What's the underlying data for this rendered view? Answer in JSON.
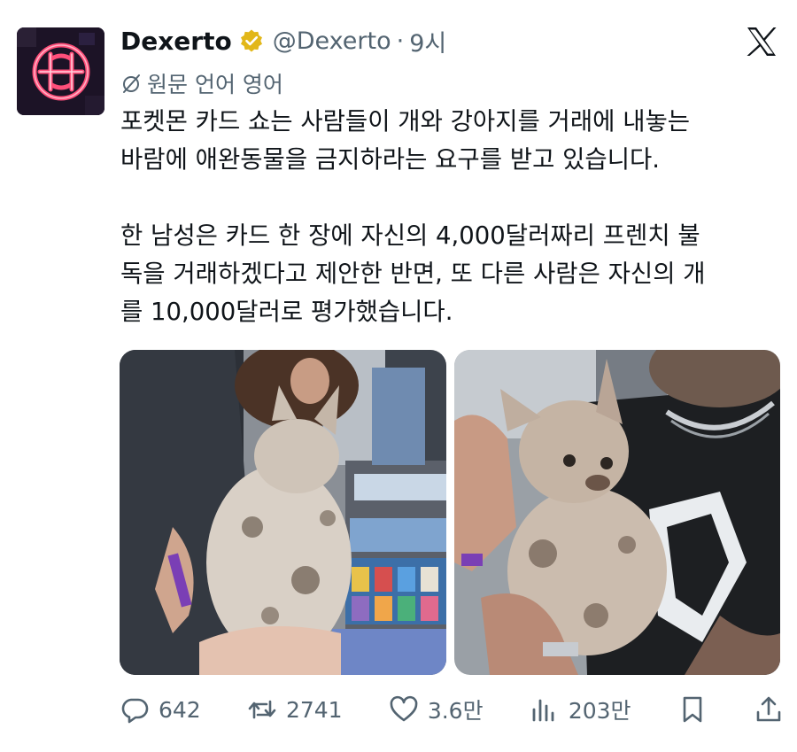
{
  "tweet": {
    "author_name": "Dexerto",
    "handle": "@Dexerto",
    "separator": "·",
    "time": "9시",
    "translated_label": "원문 언어 영어",
    "text_lines": [
      "포켓몬 카드 쇼는 사람들이 개와 강아지를 거래에 내놓는",
      "바람에 애완동물을 금지하라는 요구를 받고 있습니다.",
      "",
      "한 남성은 카드 한 장에 자신의 4,000달러짜리 프렌치 불",
      "독을 거래하겠다고 제안한 반면, 또 다른 사람은 자신의 개",
      "를 10,000달러로 평가했습니다."
    ]
  },
  "actions": {
    "replies": "642",
    "reposts": "2741",
    "likes": "3.6만",
    "views": "203만"
  },
  "icons": {
    "verified": "verified-badge-icon",
    "platform": "x-logo-icon",
    "translate": "translate-slash-icon",
    "reply": "reply-icon",
    "repost": "repost-icon",
    "like": "heart-icon",
    "views": "views-icon",
    "bookmark": "bookmark-icon",
    "share": "share-icon"
  },
  "colors": {
    "text_primary": "#0f1419",
    "text_secondary": "#536471",
    "verified_gold": "#e2b719",
    "avatar_neon": "#ff3b6b"
  }
}
